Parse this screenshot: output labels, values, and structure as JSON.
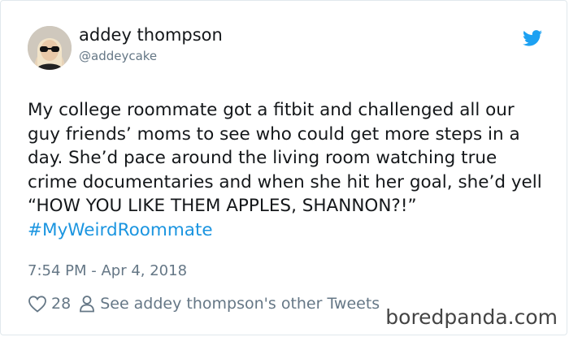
{
  "author": {
    "name": "addey thompson",
    "handle": "@addeycake"
  },
  "tweet": {
    "text": "My college roommate got a fitbit and challenged all our guy friends’ moms to see who could get more steps in a day. She’d pace around the living room watching true crime documentaries and when she hit her goal, she’d yell “HOW YOU LIKE THEM APPLES, SHANNON?!”",
    "hashtag": "#MyWeirdRoommate",
    "timestamp": "7:54 PM - Apr 4, 2018"
  },
  "actions": {
    "like_count": "28",
    "other_tweets_label": "See addey thompson's other Tweets"
  },
  "icons": {
    "brand": "twitter-bird-icon",
    "like": "heart-icon",
    "profile": "person-icon"
  },
  "colors": {
    "link": "#1b95e0",
    "muted": "#657786",
    "text": "#14171a"
  },
  "watermark": "boredpanda.com"
}
